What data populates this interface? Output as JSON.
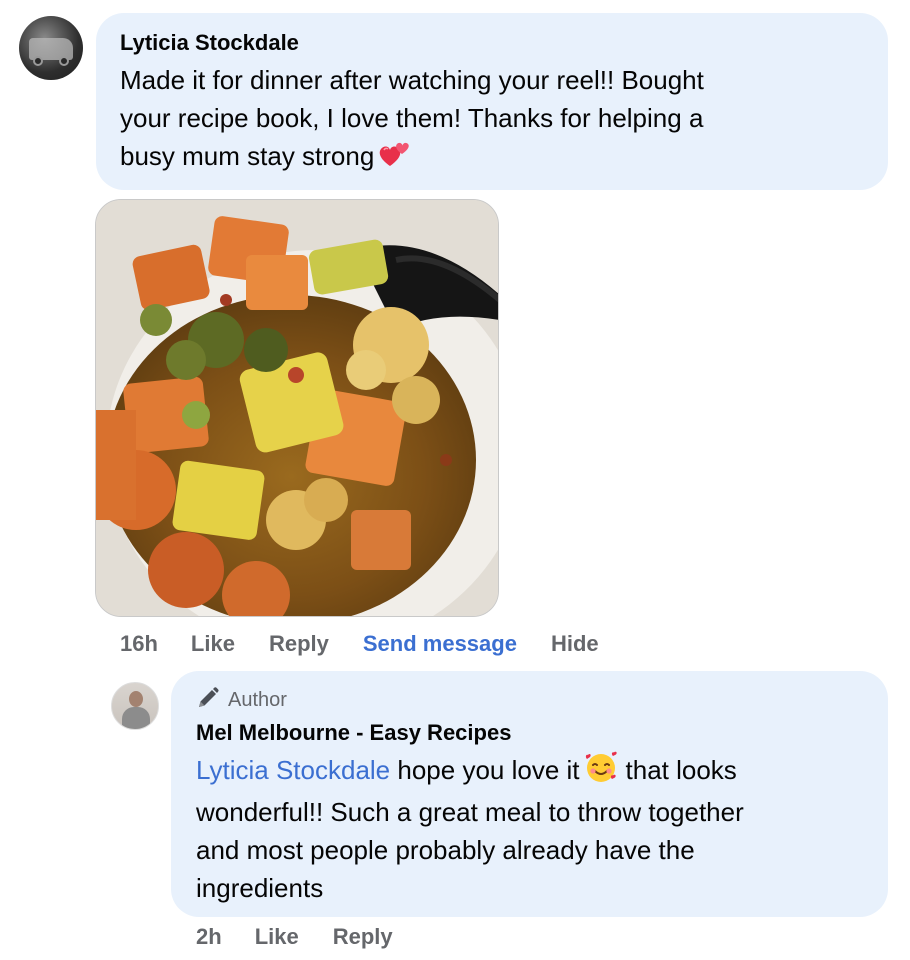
{
  "comment": {
    "author": "Lyticia Stockdale",
    "text_line1": "Made it for dinner after watching your reel!! Bought",
    "text_line2": "your recipe book, I love them! Thanks for helping a",
    "text_line3": "busy mum stay strong",
    "emoji": "two-hearts-icon",
    "actions": {
      "time": "16h",
      "like": "Like",
      "reply": "Reply",
      "send_message": "Send message",
      "hide": "Hide"
    }
  },
  "reply": {
    "badge": "Author",
    "author": "Mel Melbourne - Easy Recipes",
    "mention": "Lyticia Stockdale",
    "text_after_mention": "hope you love it",
    "emoji": "smiling-face-with-hearts-icon",
    "text_line1_end": "that looks",
    "text_line2": "wonderful!! Such a great meal to throw together",
    "text_line3": "and most people probably already have the",
    "text_line4": "ingredients",
    "actions": {
      "time": "2h",
      "like": "Like",
      "reply": "Reply"
    }
  },
  "colors": {
    "bubble": "#e8f1fc",
    "link": "#3b6fd1",
    "muted": "#65676b"
  }
}
